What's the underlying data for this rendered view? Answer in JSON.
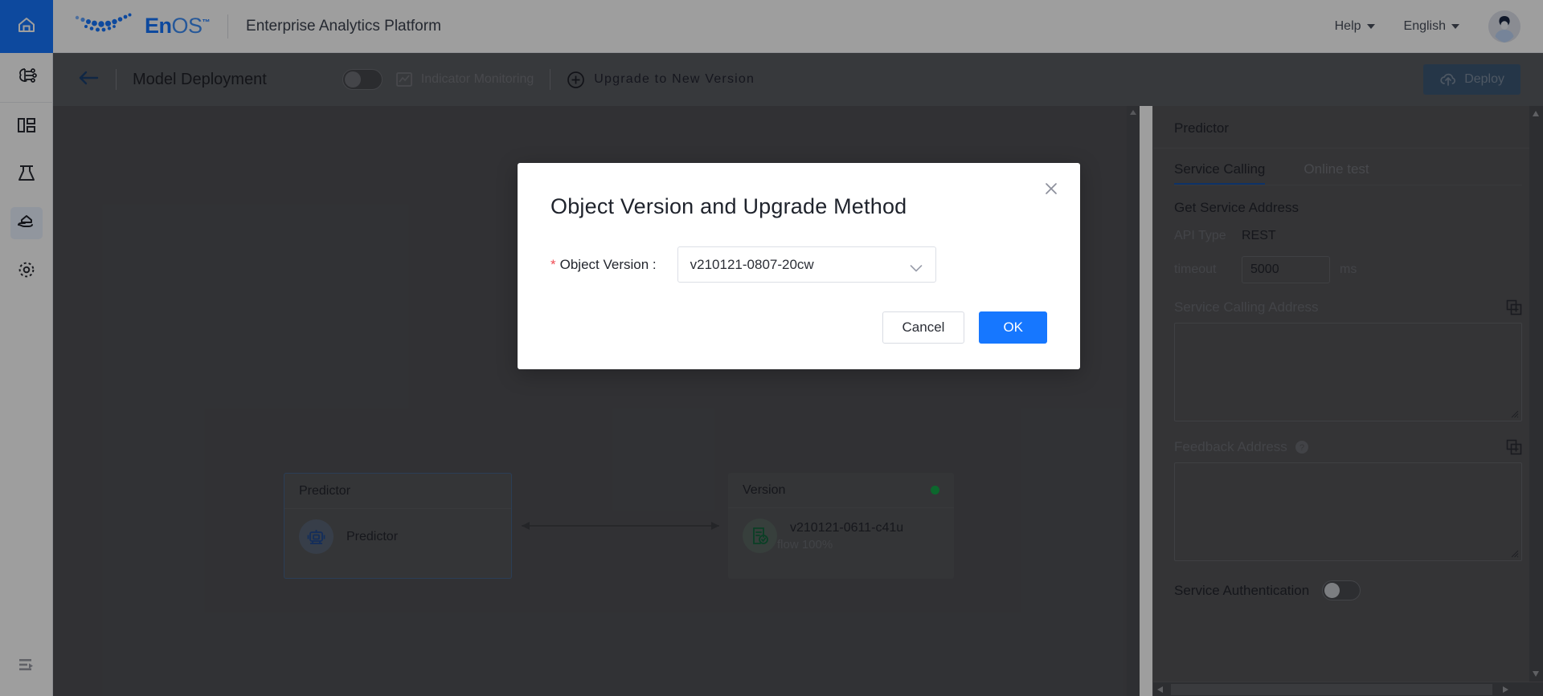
{
  "header": {
    "brand_name_bold": "En",
    "brand_name_light": "OS",
    "brand_tm": "™",
    "app_subtitle": "Enterprise Analytics Platform",
    "help_label": "Help",
    "language_label": "English",
    "home_icon": "home-icon",
    "avatar_icon": "user-avatar-icon"
  },
  "sidebar": {
    "items": [
      {
        "name": "ai-brain-icon",
        "label": "AI Studio",
        "active": false
      },
      {
        "name": "dashboard-icon",
        "label": "Dashboard",
        "active": false
      },
      {
        "name": "flask-lab-icon",
        "label": "Experiments",
        "active": false
      },
      {
        "name": "deployment-hand-icon",
        "label": "Model Deployment",
        "active": true
      },
      {
        "name": "settings-target-icon",
        "label": "Settings",
        "active": false
      }
    ],
    "collapse_icon": "collapse-panel-icon"
  },
  "toolbar": {
    "back_icon": "back-arrow-icon",
    "page_title": "Model Deployment",
    "indicator_toggle_state": "off",
    "indicator_label": "Indicator  Monitoring",
    "indicator_icon": "chart-monitor-icon",
    "upgrade_label": "Upgrade  to  New  Version",
    "upgrade_icon": "plus-circle-icon",
    "deploy_label": "Deploy",
    "deploy_icon": "cloud-upload-icon"
  },
  "canvas": {
    "nodes": [
      {
        "header": "Predictor",
        "icon": "predictor-robot-icon",
        "label": "Predictor",
        "sub": "",
        "status": false
      },
      {
        "header": "Version",
        "icon": "version-document-check-icon",
        "label": "v210121-0611-c41u",
        "sub": "flow 100%",
        "status": true
      }
    ],
    "connector_icon": "bidirectional-arrow"
  },
  "right_panel": {
    "title": "Predictor",
    "tabs": [
      {
        "label": "Service Calling",
        "active": true
      },
      {
        "label": "Online test",
        "active": false
      }
    ],
    "section_title": "Get Service Address",
    "api_type_key": "API Type",
    "api_type_value": "REST",
    "timeout_key": "timeout",
    "timeout_value": "5000",
    "timeout_unit": "ms",
    "service_calling_address_label": "Service Calling Address",
    "service_calling_address_value": "",
    "feedback_address_label": "Feedback Address",
    "feedback_address_value": "",
    "feedback_help_icon": "question-circle-icon",
    "copy_icon": "copy-icon",
    "service_auth_label": "Service Authentication",
    "service_auth_state": "off"
  },
  "modal": {
    "title": "Object Version and Upgrade Method",
    "required_mark": "*",
    "field_label": "Object Version :",
    "field_value": "v210121-0807-20cw",
    "close_icon": "close-icon",
    "chevron_icon": "chevron-down-icon",
    "cancel_label": "Cancel",
    "ok_label": "OK"
  },
  "colors": {
    "accent_blue": "#1677ff",
    "tab_underline": "#1552a8",
    "status_green": "#14a64a",
    "required_red": "#ef4b53",
    "canvas_bg": "#4f5055",
    "toolbar_bg": "#5a5c61"
  }
}
